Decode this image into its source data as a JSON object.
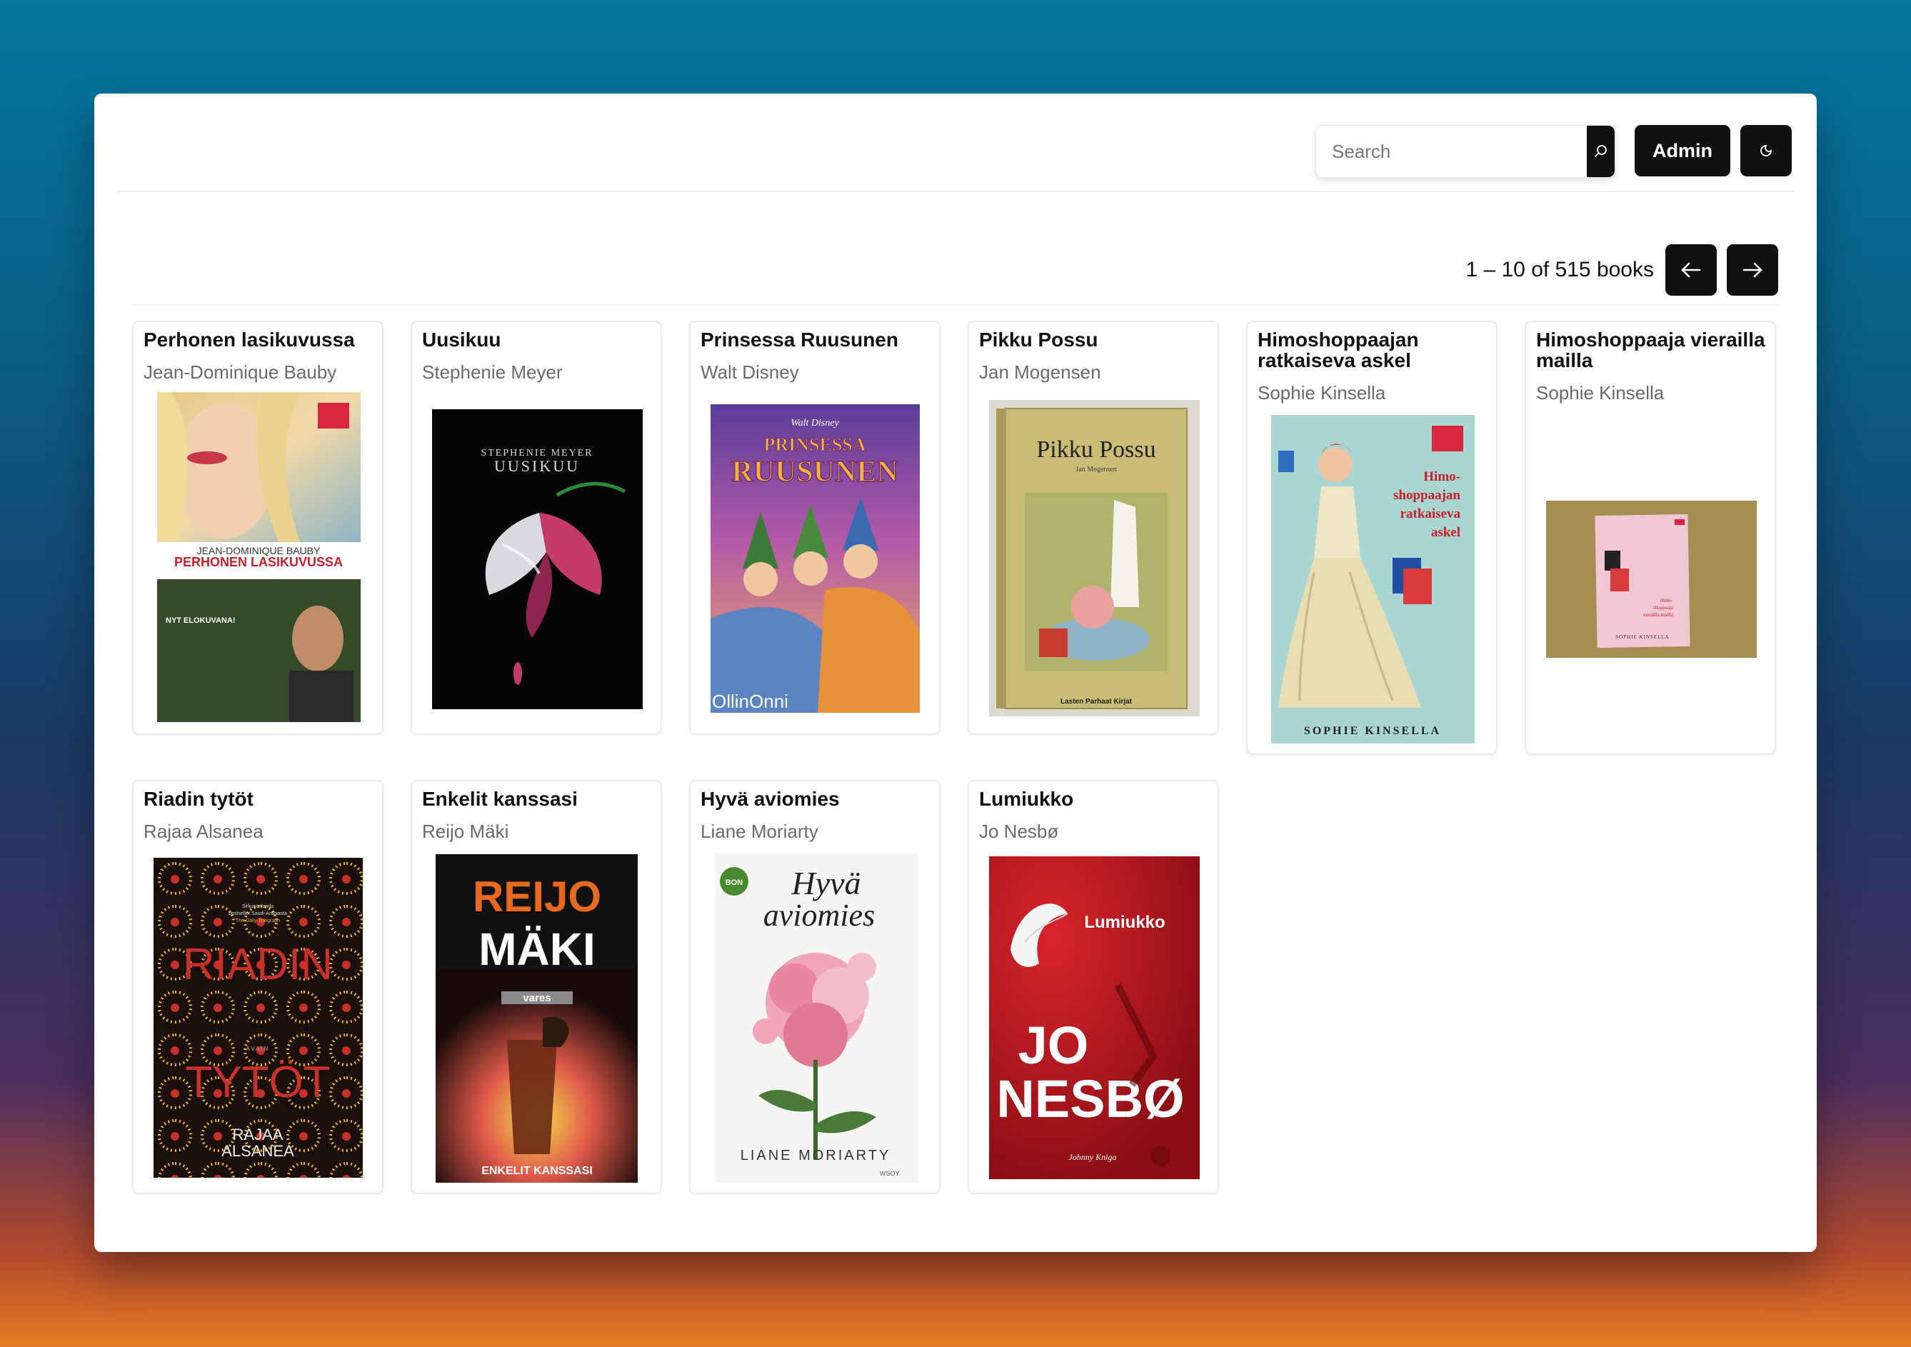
{
  "header": {
    "search_placeholder": "Search",
    "admin_label": "Admin"
  },
  "pager": {
    "summary": "1 – 10 of 515 books",
    "prev_icon": "arrow-left-icon",
    "next_icon": "arrow-right-icon"
  },
  "books": [
    {
      "title": "Perhonen lasikuvussa",
      "author": "Jean-Dominique Bauby",
      "cover_text": [
        "JEAN-DOMINIQUE BAUBY",
        "PERHONEN LASIKUVUSSA",
        "NYT ELOKUVANA!"
      ]
    },
    {
      "title": "Uusikuu",
      "author": "Stephenie Meyer",
      "cover_text": [
        "STEPHENIE MEYER",
        "UUSIKUU"
      ]
    },
    {
      "title": "Prinsessa Ruusunen",
      "author": "Walt Disney",
      "cover_text": [
        "Walt Disney",
        "PRINSESSA",
        "RUUSUNEN",
        "OllinOnni"
      ]
    },
    {
      "title": "Pikku Possu",
      "author": "Jan Mogensen",
      "cover_text": [
        "Pikku Possu",
        "Jan Mogensen",
        "Lasten Parhaat Kirjat"
      ]
    },
    {
      "title": "Himoshoppaajan ratkaiseva askel",
      "author": "Sophie Kinsella",
      "cover_text": [
        "Himo-",
        "shoppaajan",
        "ratkaiseva",
        "askel",
        "SOPHIE KINSELLA"
      ]
    },
    {
      "title": "Himoshoppaaja vierailla mailla",
      "author": "Sophie Kinsella",
      "cover_text": [
        "Himo-",
        "shoppaaja",
        "vierailla mailla",
        "SOPHIE KINSELLA"
      ]
    },
    {
      "title": "Riadin tytöt",
      "author": "Rajaa Alsanea",
      "cover_text": [
        "Sirkusonlanda",
        "bestseller Saudi-Arabiasta",
        "The Daily Telegraph",
        "RIADIN",
        "AVAIN",
        "TYTÖT",
        "RAJAA",
        "ALSANEA"
      ]
    },
    {
      "title": "Enkelit kanssasi",
      "author": "Reijo Mäki",
      "cover_text": [
        "REIJO",
        "MÄKI",
        "vares",
        "ENKELIT KANSSASI"
      ]
    },
    {
      "title": "Hyvä aviomies",
      "author": "Liane Moriarty",
      "cover_text": [
        "BON",
        "Hyvä",
        "aviomies",
        "LIANE MORIARTY",
        "WSOY"
      ]
    },
    {
      "title": "Lumiukko",
      "author": "Jo Nesbø",
      "cover_text": [
        "Lumiukko",
        "JO",
        "NESBØ",
        "Johnny Kniga"
      ]
    }
  ],
  "icons": {
    "search": "search-icon",
    "theme": "theme-toggle-icon"
  }
}
